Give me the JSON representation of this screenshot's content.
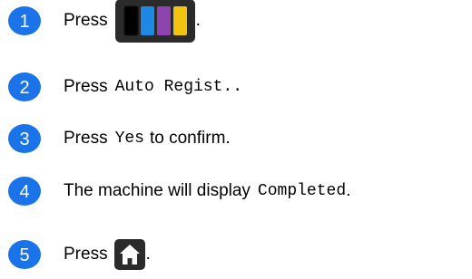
{
  "colors": {
    "step_badge": "#1a73e8",
    "icon_bg": "#2b2b2b",
    "ink_black": "#000000",
    "ink_cyan": "#1e88e5",
    "ink_magenta": "#8e44ad",
    "ink_yellow": "#f1c40f"
  },
  "steps": [
    {
      "number": "1",
      "text_before": "Press",
      "icon": "ink-icon",
      "text_after": "."
    },
    {
      "number": "2",
      "text_before": "Press",
      "code": "Auto Regist..",
      "text_after": ""
    },
    {
      "number": "3",
      "text_before": "Press",
      "code": "Yes",
      "text_after": "to confirm."
    },
    {
      "number": "4",
      "text_before": "The machine will display",
      "code": "Completed",
      "text_after": "."
    },
    {
      "number": "5",
      "text_before": "Press",
      "icon": "home-icon",
      "text_after": "."
    }
  ]
}
